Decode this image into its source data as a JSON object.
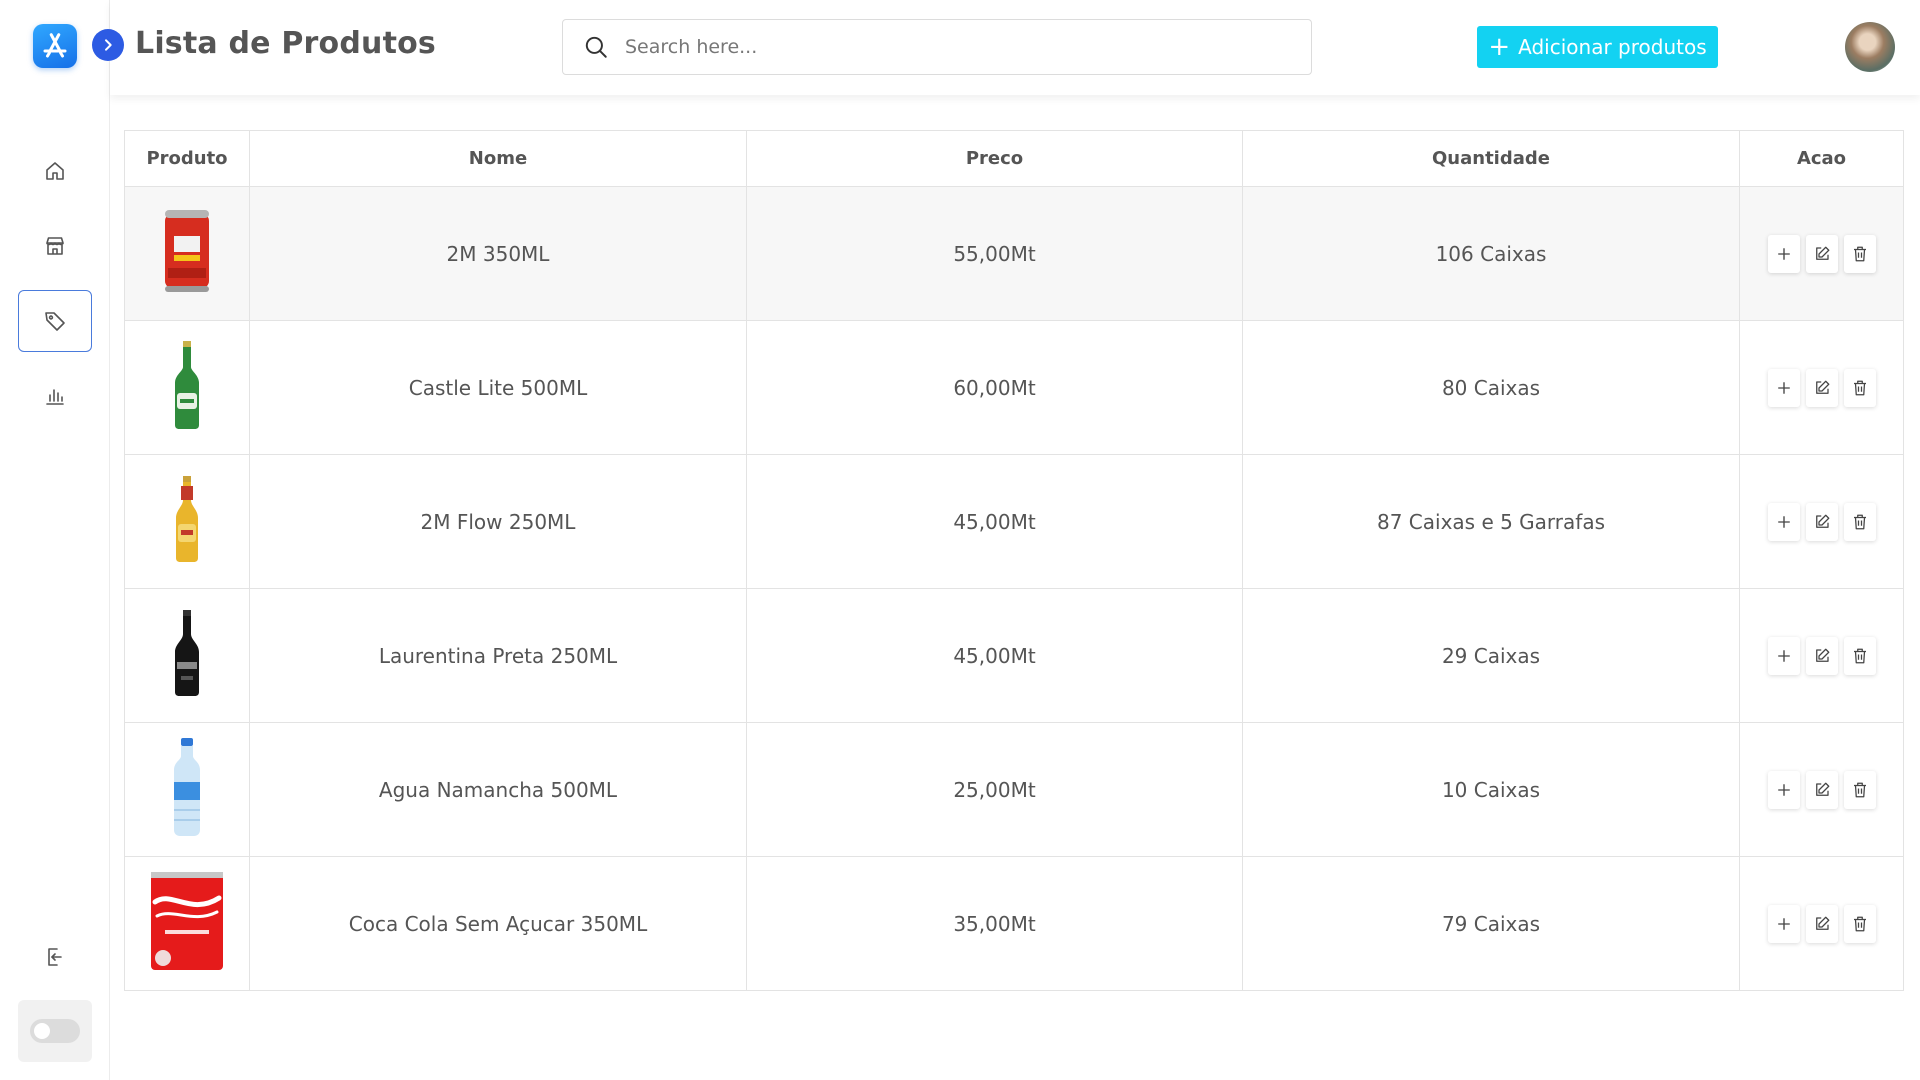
{
  "header": {
    "title": "Lista de Produtos",
    "search_placeholder": "Search here...",
    "add_button_label": "Adicionar produtos"
  },
  "sidebar": {
    "items": [
      {
        "name": "home",
        "icon": "home-icon",
        "active": false
      },
      {
        "name": "store",
        "icon": "store-icon",
        "active": false
      },
      {
        "name": "products",
        "icon": "tag-icon",
        "active": true
      },
      {
        "name": "reports",
        "icon": "bar-chart-icon",
        "active": false
      }
    ],
    "logout_icon": "logout-icon",
    "theme_toggle": "toggle-switch"
  },
  "table": {
    "columns": [
      "Produto",
      "Nome",
      "Preco",
      "Quantidade",
      "Acao"
    ],
    "rows": [
      {
        "image": "red-can",
        "nome": "2M 350ML",
        "preco": "55,00Mt",
        "quantidade": "106 Caixas"
      },
      {
        "image": "green-bottle",
        "nome": "Castle Lite 500ML",
        "preco": "60,00Mt",
        "quantidade": "80 Caixas"
      },
      {
        "image": "yellow-bottle",
        "nome": "2M Flow 250ML",
        "preco": "45,00Mt",
        "quantidade": "87 Caixas e 5 Garrafas"
      },
      {
        "image": "black-bottle",
        "nome": "Laurentina Preta 250ML",
        "preco": "45,00Mt",
        "quantidade": "29 Caixas"
      },
      {
        "image": "water-bottle",
        "nome": "Agua Namancha 500ML",
        "preco": "25,00Mt",
        "quantidade": "10 Caixas"
      },
      {
        "image": "coke-can",
        "nome": "Coca Cola Sem Açucar 350ML",
        "preco": "35,00Mt",
        "quantidade": "79 Caixas"
      }
    ]
  },
  "colors": {
    "accent": "#13d2f2",
    "primary": "#2d5be3",
    "logo": "#1e90ff"
  }
}
